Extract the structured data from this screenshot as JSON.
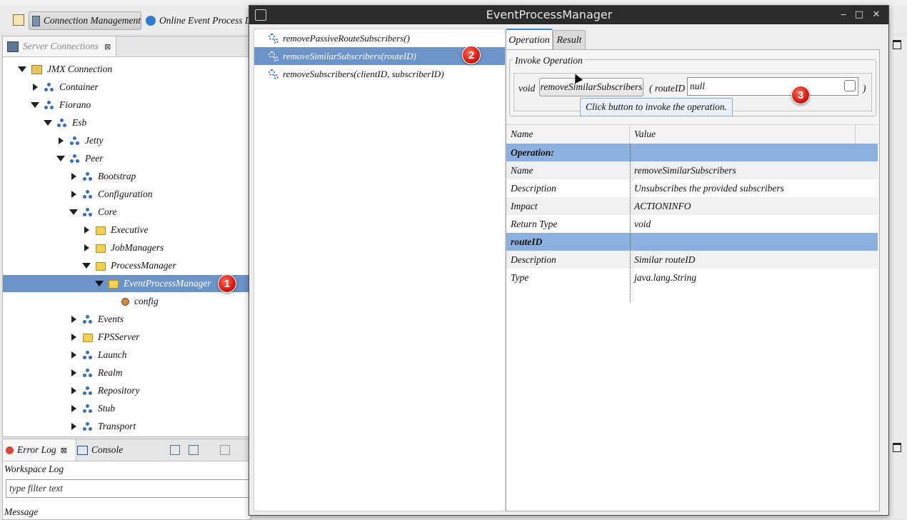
{
  "toolbar": {
    "perspective_active": "Connection Management",
    "perspective_other": "Online Event Process D"
  },
  "server_connections": {
    "tab_label": "Server Connections",
    "tree": [
      {
        "label": "JMX Connection",
        "level": 1,
        "state": "expanded",
        "icon": "jmx-connection-icon"
      },
      {
        "label": "Container",
        "level": 2,
        "state": "collapsed",
        "icon": "mbean-icon"
      },
      {
        "label": "Fiorano",
        "level": 2,
        "state": "expanded",
        "icon": "mbean-icon"
      },
      {
        "label": "Esb",
        "level": 3,
        "state": "expanded",
        "icon": "mbean-icon"
      },
      {
        "label": "Jetty",
        "level": 4,
        "state": "collapsed",
        "icon": "mbean-icon"
      },
      {
        "label": "Peer",
        "level": 4,
        "state": "expanded",
        "icon": "mbean-icon"
      },
      {
        "label": "Bootstrap",
        "level": 5,
        "state": "collapsed",
        "icon": "mbean-icon"
      },
      {
        "label": "Configuration",
        "level": 5,
        "state": "collapsed",
        "icon": "mbean-icon"
      },
      {
        "label": "Core",
        "level": 5,
        "state": "expanded",
        "icon": "mbean-icon"
      },
      {
        "label": "Executive",
        "level": 6,
        "state": "collapsed",
        "icon": "folder-icon"
      },
      {
        "label": "JobManagers",
        "level": 6,
        "state": "collapsed",
        "icon": "folder-icon"
      },
      {
        "label": "ProcessManager",
        "level": 6,
        "state": "expanded",
        "icon": "folder-icon"
      },
      {
        "label": "EventProcessManager",
        "level": 7,
        "state": "expanded",
        "icon": "folder-icon",
        "selected": true
      },
      {
        "label": "config",
        "level": 8,
        "state": "leaf",
        "icon": "attribute-icon"
      },
      {
        "label": "Events",
        "level": 5,
        "state": "collapsed",
        "icon": "mbean-icon"
      },
      {
        "label": "FPSServer",
        "level": 5,
        "state": "collapsed",
        "icon": "folder-icon"
      },
      {
        "label": "Launch",
        "level": 5,
        "state": "collapsed",
        "icon": "mbean-icon"
      },
      {
        "label": "Realm",
        "level": 5,
        "state": "collapsed",
        "icon": "mbean-icon"
      },
      {
        "label": "Repository",
        "level": 5,
        "state": "collapsed",
        "icon": "mbean-icon"
      },
      {
        "label": "Stub",
        "level": 5,
        "state": "collapsed",
        "icon": "mbean-icon"
      },
      {
        "label": "Transport",
        "level": 5,
        "state": "collapsed",
        "icon": "mbean-icon"
      }
    ]
  },
  "error_log": {
    "tab_label": "Error Log",
    "console_label": "Console",
    "workspace_log": "Workspace Log",
    "filter_placeholder": "type filter text",
    "column_message": "Message"
  },
  "dialog": {
    "title": "EventProcessManager",
    "operations": [
      {
        "label": "removePassiveRouteSubscribers()",
        "selected": false
      },
      {
        "label": "removeSimilarSubscribers(routeID)",
        "selected": true
      },
      {
        "label": "removeSubscribers(clientID, subscriberID)",
        "selected": false
      }
    ],
    "tabs": {
      "operation": "Operation",
      "result": "Result"
    },
    "invoke": {
      "group_title": "Invoke Operation",
      "return_type": "void",
      "button_label": "removeSimilarSubscribers",
      "param_open": "( routeID",
      "param_value": "null",
      "param_close": ")",
      "tooltip": "Click button to invoke the operation."
    },
    "properties": {
      "col_name": "Name",
      "col_value": "Value",
      "rows": [
        {
          "name": "Operation:",
          "value": "",
          "section": true
        },
        {
          "name": "Name",
          "value": "removeSimilarSubscribers"
        },
        {
          "name": "Description",
          "value": "Unsubscribes the provided subscribers"
        },
        {
          "name": "Impact",
          "value": "ACTIONINFO"
        },
        {
          "name": "Return Type",
          "value": "void"
        },
        {
          "name": "routeID",
          "value": "",
          "section": true
        },
        {
          "name": "Description",
          "value": "Similar routeID"
        },
        {
          "name": "Type",
          "value": "java.lang.String"
        }
      ]
    }
  },
  "callouts": [
    "1",
    "2",
    "3"
  ],
  "colors": {
    "selection": "#6d94c8",
    "section_row": "#8db1de",
    "titlebar": "#2b2b2b",
    "callout": "#d31a10"
  }
}
